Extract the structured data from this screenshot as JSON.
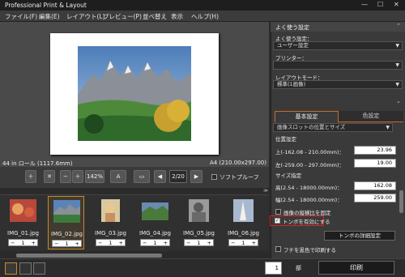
{
  "app": {
    "title": "Professional Print & Layout",
    "window_controls": [
      "—",
      "☐",
      "✕"
    ]
  },
  "menu": {
    "items": [
      "ファイル(F)",
      "編集(E)",
      "レイアウト(L)",
      "プレビュー(P)",
      "並べ替え",
      "表示",
      "ヘルプ(H)"
    ]
  },
  "preview": {
    "paper_label": "44 in ロール (1117.6mm)",
    "size_label": "A4 (210.00x297.00)"
  },
  "toolbar": {
    "zoom_value": "142%",
    "page_indicator": "2/20",
    "softproof_label": "ソフトプルーフ"
  },
  "thumbnails": [
    {
      "name": "IMG_01.jpg",
      "count": "1",
      "minus": "−",
      "plus": "+",
      "color": "#b8483a",
      "color2": "#e8a060"
    },
    {
      "name": "IMG_02.jpg",
      "count": "1",
      "minus": "−",
      "plus": "+",
      "color": "#4a6a8a",
      "color2": "#3c7a3c"
    },
    {
      "name": "IMG_03.jpg",
      "count": "1",
      "minus": "−",
      "plus": "+",
      "color": "#d8c8a0",
      "color2": "#c89060"
    },
    {
      "name": "IMG_04.jpg",
      "count": "1",
      "minus": "−",
      "plus": "+",
      "color": "#6a8ab0",
      "color2": "#4a7a3a"
    },
    {
      "name": "IMG_05.jpg",
      "count": "1",
      "minus": "−",
      "plus": "+",
      "color": "#9a9a9a",
      "color2": "#5a5a5a"
    },
    {
      "name": "IMG_06.jpg",
      "count": "1",
      "minus": "−",
      "plus": "+",
      "color": "#d8c8b0",
      "color2": "#a8b8d0"
    }
  ],
  "bottom": {
    "copies": "1",
    "copies_unit": "部",
    "print_label": "印刷"
  },
  "panel": {
    "header": "よく使う設定",
    "favorites_label": "よく使う設定：",
    "favorites_value": "ユーザー設定",
    "printer_label": "プリンター：",
    "printer_value": "",
    "layout_mode_label": "レイアウトモード：",
    "layout_mode_value": "標準(1画像)",
    "tabs": [
      "基本設定",
      "色設定"
    ],
    "section_dropdown": "画像スロットの位置とサイズ",
    "position_title": "位置設定",
    "top_label": "上(-162.08 - 210.00mm)：",
    "top_value": "23.96",
    "left_label": "左(-259.00 - 297.00mm)：",
    "left_value": "19.00",
    "size_title": "サイズ指定",
    "height_label": "高(2.54 - 18000.00mm)：",
    "height_value": "162.08",
    "width_label": "幅(2.54 - 18000.00mm)：",
    "width_value": "259.00",
    "aspect_label": "画像の縦横比を固定",
    "crop_marks_label": "トンボを有効にする",
    "crop_marks_button": "トンボの詳細設定",
    "black_print_label": "フチを黒色で印刷する"
  }
}
